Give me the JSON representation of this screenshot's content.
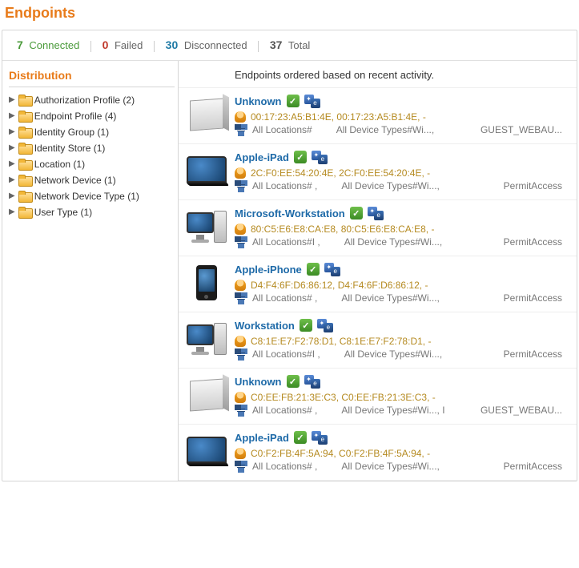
{
  "title": "Endpoints",
  "summary": {
    "connected": {
      "count": "7",
      "label": "Connected"
    },
    "failed": {
      "count": "0",
      "label": "Failed"
    },
    "disconnected": {
      "count": "30",
      "label": "Disconnected"
    },
    "total": {
      "count": "37",
      "label": "Total"
    }
  },
  "sidebar": {
    "title": "Distribution",
    "items": [
      {
        "label": "Authorization Profile (2)"
      },
      {
        "label": "Endpoint Profile (4)"
      },
      {
        "label": "Identity Group (1)"
      },
      {
        "label": "Identity Store (1)"
      },
      {
        "label": "Location (1)"
      },
      {
        "label": "Network Device (1)"
      },
      {
        "label": "Network Device Type (1)"
      },
      {
        "label": "User Type (1)"
      }
    ]
  },
  "main": {
    "heading": "Endpoints ordered based on recent activity.",
    "endpoints": [
      {
        "name": "Unknown",
        "device": "cube",
        "mac": "00:17:23:A5:B1:4E,  00:17:23:A5:B1:4E,  -",
        "loc": "All Locations#",
        "dev": "All Device Types#Wi...,",
        "extra": "GUEST_WEBAU..."
      },
      {
        "name": "Apple-iPad",
        "device": "tablet",
        "mac": "2C:F0:EE:54:20:4E,  2C:F0:EE:54:20:4E,  -",
        "loc": "All Locations#     ,",
        "dev": "All Device Types#Wi...,",
        "extra": "PermitAccess"
      },
      {
        "name": "Microsoft-Workstation",
        "device": "workstation",
        "mac": "80:C5:E6:E8:CA:E8,  80:C5:E6:E8:CA:E8,  -",
        "loc": "All Locations#I     ,",
        "dev": "All Device Types#Wi...,",
        "extra": "PermitAccess"
      },
      {
        "name": "Apple-iPhone",
        "device": "phone",
        "mac": "D4:F4:6F:D6:86:12,  D4:F4:6F:D6:86:12,  -",
        "loc": "All Locations#     ,",
        "dev": "All Device Types#Wi...,",
        "extra": "PermitAccess"
      },
      {
        "name": "Workstation",
        "device": "workstation",
        "mac": "C8:1E:E7:F2:78:D1,  C8:1E:E7:F2:78:D1,  -",
        "loc": "All Locations#I     ,",
        "dev": "All Device Types#Wi...,",
        "extra": "PermitAccess"
      },
      {
        "name": "Unknown",
        "device": "cube",
        "mac": "C0:EE:FB:21:3E:C3,  C0:EE:FB:21:3E:C3,  -",
        "loc": "All Locations#     ,",
        "dev": "All Device Types#Wi...,  I",
        "extra": "GUEST_WEBAU..."
      },
      {
        "name": "Apple-iPad",
        "device": "tablet",
        "mac": "C0:F2:FB:4F:5A:94,  C0:F2:FB:4F:5A:94,  -",
        "loc": "All Locations#     ,",
        "dev": "All Device Types#Wi...,",
        "extra": "PermitAccess"
      }
    ]
  }
}
